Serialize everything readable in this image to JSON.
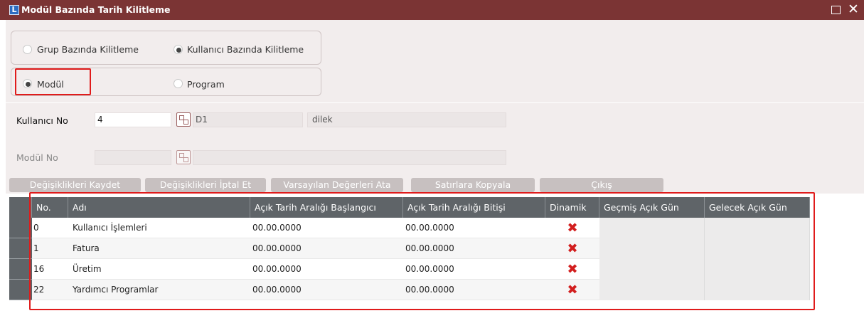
{
  "window": {
    "title": "Modül Bazında Tarih Kilitleme",
    "app_icon": "L"
  },
  "radio_group1": {
    "options": [
      {
        "label": "Grup Bazında Kilitleme",
        "selected": false
      },
      {
        "label": "Kullanıcı Bazında Kilitleme",
        "selected": true
      }
    ]
  },
  "radio_group2": {
    "options": [
      {
        "label": "Modül",
        "selected": true
      },
      {
        "label": "Program",
        "selected": false
      }
    ]
  },
  "form": {
    "kullanici_no_label": "Kullanıcı No",
    "kullanici_no_value": "4",
    "kullanici_code": "D1",
    "kullanici_name": "dilek",
    "modul_no_label": "Modül No",
    "modul_no_value": ""
  },
  "toolbar": {
    "save_label": "Değişiklikleri Kaydet",
    "cancel_label": "Değişiklikleri İptal Et",
    "defaults_label": "Varsayılan Değerleri Ata",
    "copy_label": "Satırlara Kopyala",
    "exit_label": "Çıkış"
  },
  "table": {
    "headers": [
      "No.",
      "Adı",
      "Açık Tarih Aralığı Başlangıcı",
      "Açık Tarih Aralığı Bitişi",
      "Dinamik",
      "Geçmiş Açık Gün",
      "Gelecek Açık Gün"
    ],
    "rows": [
      {
        "no": "0",
        "name": "Kullanıcı İşlemleri",
        "start": "00.00.0000",
        "end": "00.00.0000",
        "dinamik": "✖",
        "past": "",
        "future": ""
      },
      {
        "no": "1",
        "name": "Fatura",
        "start": "00.00.0000",
        "end": "00.00.0000",
        "dinamik": "✖",
        "past": "",
        "future": ""
      },
      {
        "no": "16",
        "name": "Üretim",
        "start": "00.00.0000",
        "end": "00.00.0000",
        "dinamik": "✖",
        "past": "",
        "future": ""
      },
      {
        "no": "22",
        "name": "Yardımcı Programlar",
        "start": "00.00.0000",
        "end": "00.00.0000",
        "dinamik": "✖",
        "past": "",
        "future": ""
      }
    ]
  },
  "colors": {
    "titlebar": "#7b3434",
    "panel": "#f2eded",
    "header": "#5f6468",
    "highlight": "#e01b1b",
    "x_mark": "#d21e1e"
  }
}
